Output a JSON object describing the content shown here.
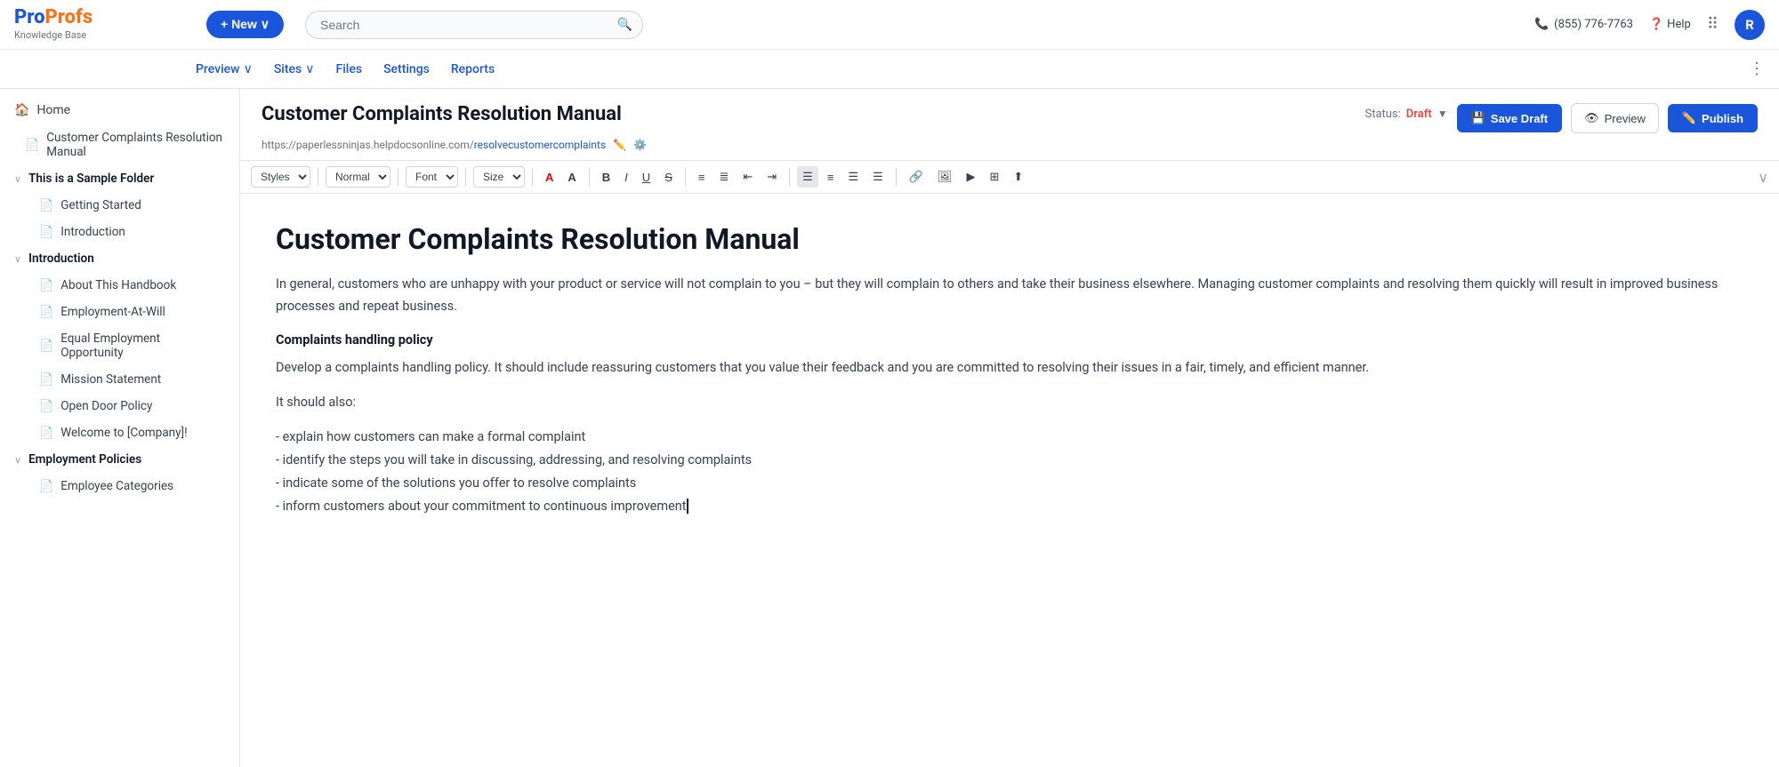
{
  "brand": {
    "name_part1": "Pro",
    "name_part2": "Profs",
    "sub": "Knowledge Base"
  },
  "top_nav": {
    "new_btn": "+ New ∨",
    "search_placeholder": "Search",
    "phone": "(855) 776-7763",
    "help": "Help",
    "avatar_letter": "R"
  },
  "second_nav": {
    "items": [
      "Preview",
      "Sites",
      "Files",
      "Settings",
      "Reports"
    ],
    "preview_arrow": "∨",
    "sites_arrow": "∨"
  },
  "sidebar": {
    "home_label": "Home",
    "items": [
      {
        "label": "Customer Complaints Resolution Manual",
        "level": 1,
        "icon": "doc",
        "type": "link"
      },
      {
        "label": "This is a Sample Folder",
        "level": 0,
        "icon": "folder",
        "type": "folder",
        "expanded": true
      },
      {
        "label": "Getting Started",
        "level": 1,
        "icon": "doc",
        "type": "link"
      },
      {
        "label": "Introduction",
        "level": 1,
        "icon": "doc",
        "type": "link"
      },
      {
        "label": "Introduction",
        "level": 0,
        "icon": "folder",
        "type": "folder",
        "expanded": true
      },
      {
        "label": "About This Handbook",
        "level": 1,
        "icon": "doc",
        "type": "link"
      },
      {
        "label": "Employment-At-Will",
        "level": 1,
        "icon": "doc",
        "type": "link"
      },
      {
        "label": "Equal Employment Opportunity",
        "level": 1,
        "icon": "doc",
        "type": "link"
      },
      {
        "label": "Mission Statement",
        "level": 1,
        "icon": "doc",
        "type": "link"
      },
      {
        "label": "Open Door Policy",
        "level": 1,
        "icon": "doc",
        "type": "link"
      },
      {
        "label": "Welcome to [Company]!",
        "level": 1,
        "icon": "doc",
        "type": "link"
      },
      {
        "label": "Employment Policies",
        "level": 0,
        "icon": "folder",
        "type": "folder",
        "expanded": true
      },
      {
        "label": "Employee Categories",
        "level": 1,
        "icon": "doc",
        "type": "link"
      }
    ]
  },
  "article": {
    "title": "Customer Complaints Resolution Manual",
    "url_prefix": "https://paperlessninjas.helpdocsonline.com/",
    "url_slug": "resolvecustomercomplaints",
    "status_label": "Status:",
    "status_value": "Draft",
    "save_draft_btn": "Save Draft",
    "preview_btn": "Preview",
    "publish_btn": "Publish",
    "h1": "Customer Complaints Resolution Manual",
    "intro_p": "In general, customers who are unhappy with your product or service will not complain to you – but they will complain to others and take their business elsewhere. Managing customer complaints and resolving them quickly will result in improved business processes and repeat business.",
    "section1_heading": "Complaints handling policy",
    "section1_p": "Develop a complaints handling policy. It should include reassuring customers that you value their feedback and you are committed to resolving their issues in a fair, timely, and efficient manner.",
    "section2_intro": "It should also:",
    "list_items": [
      "- explain how customers can make a formal complaint",
      "- identify the steps you will take in discussing, addressing, and resolving complaints",
      "- indicate some of the solutions you offer to resolve complaints",
      "- inform customers about your commitment to continuous improvement"
    ]
  },
  "toolbar": {
    "styles_label": "Styles",
    "normal_label": "Normal",
    "font_label": "Font",
    "size_label": "Size"
  }
}
